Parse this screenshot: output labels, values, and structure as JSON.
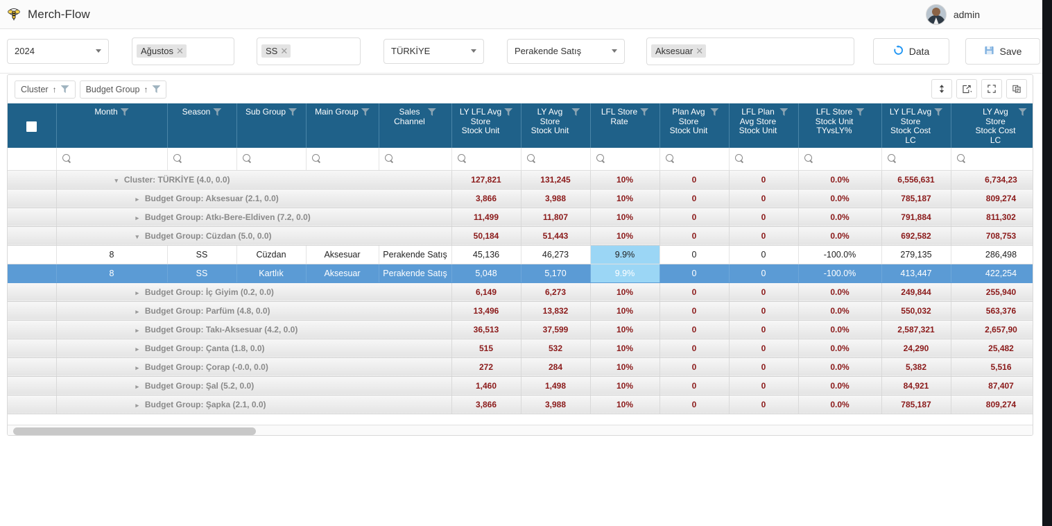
{
  "app": {
    "logo_icon": "bee-icon",
    "title": "Merch-Flow",
    "user": "admin"
  },
  "filters": {
    "year": {
      "value": "2024",
      "icon": "chevron-down-icon"
    },
    "month": {
      "tag": "Ağustos",
      "remove_icon": "close-icon"
    },
    "season": {
      "tag": "SS",
      "remove_icon": "close-icon"
    },
    "cluster": {
      "value": "TÜRKİYE",
      "icon": "chevron-down-icon"
    },
    "channel": {
      "value": "Perakende Satış",
      "icon": "chevron-down-icon"
    },
    "budget_group": {
      "tag": "Aksesuar",
      "remove_icon": "close-icon"
    },
    "data_button": {
      "label": "Data",
      "icon": "refresh-icon",
      "color": "#2196f3"
    },
    "save_button": {
      "label": "Save",
      "icon": "floppy-disk-icon",
      "color": "#6fa8dc"
    }
  },
  "grid_toolbar": {
    "row_groups": [
      {
        "label": "Cluster",
        "sort_icon": "sort-asc-icon",
        "filter_icon": "funnel-icon"
      },
      {
        "label": "Budget Group",
        "sort_icon": "sort-asc-icon",
        "filter_icon": "funnel-icon"
      }
    ],
    "buttons": [
      {
        "name": "row-height-button",
        "icon": "vertical-arrows-icon"
      },
      {
        "name": "export-button",
        "icon": "export-icon"
      },
      {
        "name": "fullscreen-button",
        "icon": "expand-icon"
      },
      {
        "name": "copy-button",
        "icon": "duplicate-icon"
      }
    ]
  },
  "grid": {
    "accent_header_color": "#1f6189",
    "selected_row_color": "#5b9bd5",
    "highlight_cell_color": "#9bd6f5",
    "group_value_color": "#8b1a1a",
    "columns": [
      {
        "label": "",
        "name": "select-all-column",
        "filter": false,
        "search": false
      },
      {
        "label": "Month",
        "name": "column-month",
        "filter": true,
        "search": true
      },
      {
        "label": "Season",
        "name": "column-season",
        "filter": true,
        "search": true
      },
      {
        "label": "Sub Group",
        "name": "column-sub-group",
        "filter": true,
        "search": true
      },
      {
        "label": "Main Group",
        "name": "column-main-group",
        "filter": true,
        "search": true
      },
      {
        "label": "Sales\nChannel",
        "name": "column-sales-channel",
        "filter": true,
        "search": true
      },
      {
        "label": "LY LFL Avg\nStore\nStock Unit",
        "name": "column-ly-lfl-avg-store-stock-unit",
        "filter": true,
        "search": true
      },
      {
        "label": "LY Avg\nStore\nStock Unit",
        "name": "column-ly-avg-store-stock-unit",
        "filter": true,
        "search": true
      },
      {
        "label": "LFL Store\nRate",
        "name": "column-lfl-store-rate",
        "filter": true,
        "search": true
      },
      {
        "label": "Plan Avg\nStore\nStock Unit",
        "name": "column-plan-avg-store-stock-unit",
        "filter": true,
        "search": true
      },
      {
        "label": "LFL Plan\nAvg Store\nStock Unit",
        "name": "column-lfl-plan-avg-store-stock-unit",
        "filter": true,
        "search": true
      },
      {
        "label": "LFL Store\nStock Unit\nTYvsLY%",
        "name": "column-lfl-store-stock-unit-tyvsly",
        "filter": true,
        "search": true
      },
      {
        "label": "LY LFL Avg\nStore\nStock Cost\nLC",
        "name": "column-ly-lfl-avg-store-stock-cost-lc",
        "filter": true,
        "search": true
      },
      {
        "label": "LY Avg\nStore\nStock Cost\nLC",
        "name": "column-ly-avg-store-stock-cost-lc",
        "filter": true,
        "search": true
      }
    ],
    "rows": [
      {
        "type": "group",
        "level": 0,
        "expanded": true,
        "twisty": "▾",
        "label": "Cluster: TÜRKİYE (4.0, 0.0)",
        "values": [
          "127,821",
          "131,245",
          "10%",
          "0",
          "0",
          "0.0%",
          "6,556,631",
          "6,734,23"
        ]
      },
      {
        "type": "group",
        "level": 1,
        "expanded": false,
        "twisty": "▸",
        "label": "Budget Group: Aksesuar (2.1, 0.0)",
        "values": [
          "3,866",
          "3,988",
          "10%",
          "0",
          "0",
          "0.0%",
          "785,187",
          "809,274"
        ]
      },
      {
        "type": "group",
        "level": 1,
        "expanded": false,
        "twisty": "▸",
        "label": "Budget Group: Atkı-Bere-Eldiven (7.2, 0.0)",
        "values": [
          "11,499",
          "11,807",
          "10%",
          "0",
          "0",
          "0.0%",
          "791,884",
          "811,302"
        ]
      },
      {
        "type": "group",
        "level": 1,
        "expanded": true,
        "twisty": "▾",
        "label": "Budget Group: Cüzdan (5.0, 0.0)",
        "values": [
          "50,184",
          "51,443",
          "10%",
          "0",
          "0",
          "0.0%",
          "692,582",
          "708,753"
        ]
      },
      {
        "type": "leaf",
        "selected": false,
        "month": "8",
        "season": "SS",
        "sub_group": "Cüzdan",
        "main_group": "Aksesuar",
        "sales_channel": "Perakende Satış",
        "values": [
          "45,136",
          "46,273",
          "9.9%",
          "0",
          "0",
          "-100.0%",
          "279,135",
          "286,498"
        ],
        "highlight_index": 2
      },
      {
        "type": "leaf",
        "selected": true,
        "month": "8",
        "season": "SS",
        "sub_group": "Kartlık",
        "main_group": "Aksesuar",
        "sales_channel": "Perakende Satış",
        "values": [
          "5,048",
          "5,170",
          "9.9%",
          "0",
          "0",
          "-100.0%",
          "413,447",
          "422,254"
        ],
        "highlight_index": 2
      },
      {
        "type": "group",
        "level": 1,
        "expanded": false,
        "twisty": "▸",
        "label": "Budget Group: İç Giyim (0.2, 0.0)",
        "values": [
          "6,149",
          "6,273",
          "10%",
          "0",
          "0",
          "0.0%",
          "249,844",
          "255,940"
        ]
      },
      {
        "type": "group",
        "level": 1,
        "expanded": false,
        "twisty": "▸",
        "label": "Budget Group: Parfüm (4.8, 0.0)",
        "values": [
          "13,496",
          "13,832",
          "10%",
          "0",
          "0",
          "0.0%",
          "550,032",
          "563,376"
        ]
      },
      {
        "type": "group",
        "level": 1,
        "expanded": false,
        "twisty": "▸",
        "label": "Budget Group: Takı-Aksesuar (4.2, 0.0)",
        "values": [
          "36,513",
          "37,599",
          "10%",
          "0",
          "0",
          "0.0%",
          "2,587,321",
          "2,657,90"
        ]
      },
      {
        "type": "group",
        "level": 1,
        "expanded": false,
        "twisty": "▸",
        "label": "Budget Group: Çanta (1.8, 0.0)",
        "values": [
          "515",
          "532",
          "10%",
          "0",
          "0",
          "0.0%",
          "24,290",
          "25,482"
        ]
      },
      {
        "type": "group",
        "level": 1,
        "expanded": false,
        "twisty": "▸",
        "label": "Budget Group: Çorap (-0.0, 0.0)",
        "values": [
          "272",
          "284",
          "10%",
          "0",
          "0",
          "0.0%",
          "5,382",
          "5,516"
        ]
      },
      {
        "type": "group",
        "level": 1,
        "expanded": false,
        "twisty": "▸",
        "label": "Budget Group: Şal (5.2, 0.0)",
        "values": [
          "1,460",
          "1,498",
          "10%",
          "0",
          "0",
          "0.0%",
          "84,921",
          "87,407"
        ]
      },
      {
        "type": "group",
        "level": 1,
        "expanded": false,
        "twisty": "▸",
        "label": "Budget Group: Şapka (2.1, 0.0)",
        "values": [
          "3,866",
          "3,988",
          "10%",
          "0",
          "0",
          "0.0%",
          "785,187",
          "809,274"
        ]
      }
    ]
  }
}
